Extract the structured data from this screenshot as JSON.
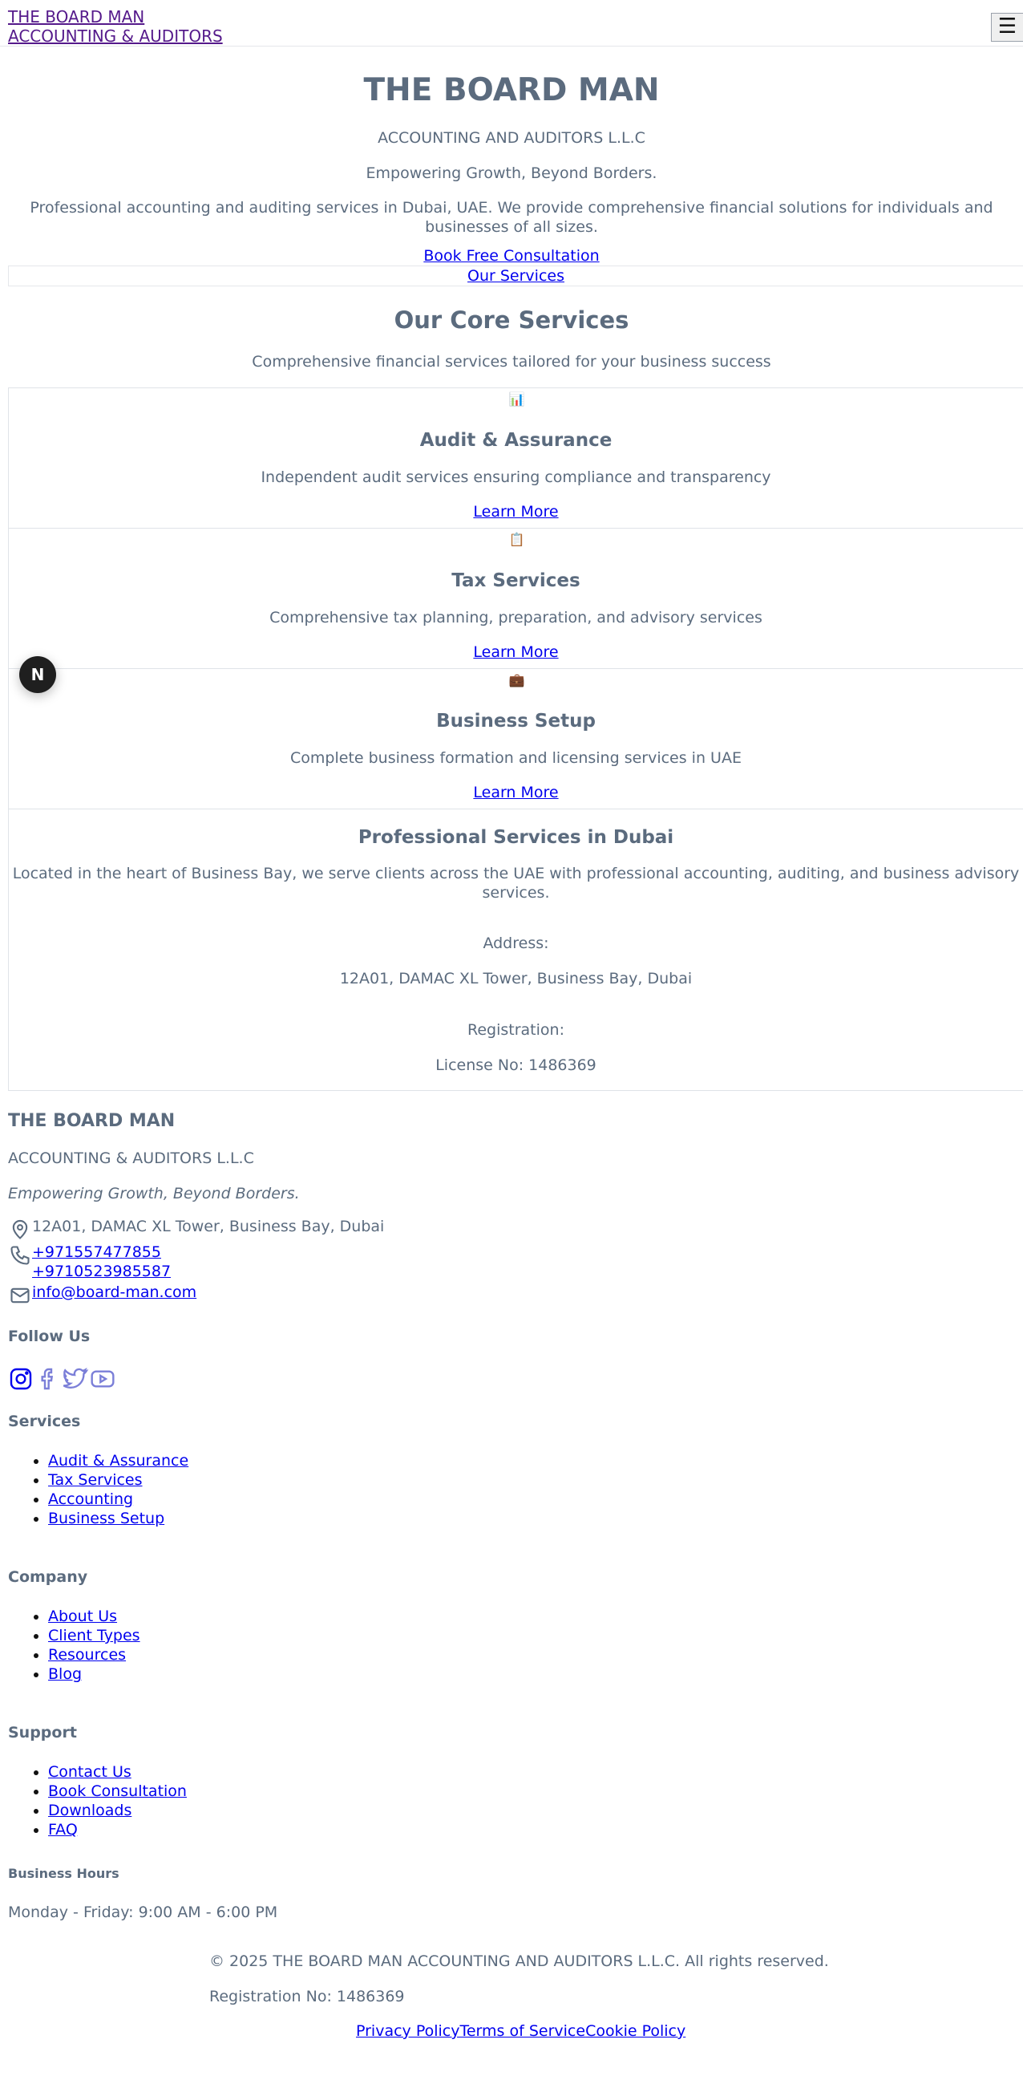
{
  "header": {
    "logo_line1": "THE BOARD MAN",
    "logo_line2": "ACCOUNTING & AUDITORS",
    "menu_icon": "☰"
  },
  "hero": {
    "title": "THE BOARD MAN",
    "subtitle": "ACCOUNTING AND AUDITORS L.L.C",
    "tagline": "Empowering Growth, Beyond Borders.",
    "description": "Professional accounting and auditing services in Dubai, UAE. We provide comprehensive financial solutions for individuals and businesses of all sizes.",
    "cta_primary": "Book Free Consultation",
    "cta_secondary": "Our Services"
  },
  "core": {
    "title": "Our Core Services",
    "subtitle": "Comprehensive financial services tailored for your business success",
    "services": [
      {
        "icon": "bar-chart-icon",
        "glyph": "📊",
        "title": "Audit & Assurance",
        "desc": "Independent audit services ensuring compliance and transparency",
        "link": "Learn More"
      },
      {
        "icon": "clipboard-icon",
        "glyph": "📋",
        "title": "Tax Services",
        "desc": "Comprehensive tax planning, preparation, and advisory services",
        "link": "Learn More"
      },
      {
        "icon": "briefcase-icon",
        "glyph": "💼",
        "title": "Business Setup",
        "desc": "Complete business formation and licensing services in UAE",
        "link": "Learn More"
      }
    ]
  },
  "professional": {
    "title": "Professional Services in Dubai",
    "desc_line1": "Located in the heart of Business Bay, we serve clients across the UAE with professional accounting, auditing, and business advisory",
    "desc_line2": "services.",
    "address_label": "Address:",
    "address_value": "12A01, DAMAC XL Tower, Business Bay, Dubai",
    "registration_label": "Registration:",
    "registration_value": "License No: 1486369"
  },
  "badge": {
    "letter": "N"
  },
  "footer": {
    "brand": "THE BOARD MAN",
    "sub": "ACCOUNTING & AUDITORS L.L.C",
    "tagline": "Empowering Growth, Beyond Borders.",
    "address": "12A01, DAMAC XL Tower, Business Bay, Dubai",
    "phone1": "+971557477855",
    "phone2": "+9710523985587",
    "email": "info@board-man.com",
    "follow_heading": "Follow Us",
    "social": [
      "instagram-icon",
      "facebook-icon",
      "twitter-icon",
      "youtube-icon"
    ],
    "services_heading": "Services",
    "services": [
      "Audit & Assurance",
      "Tax Services",
      "Accounting",
      "Business Setup"
    ],
    "company_heading": "Company",
    "company": [
      "About Us",
      "Client Types",
      "Resources",
      "Blog"
    ],
    "support_heading": "Support",
    "support": [
      "Contact Us",
      "Book Consultation",
      "Downloads",
      "FAQ"
    ],
    "hours_heading": "Business Hours",
    "hours": "Monday - Friday: 9:00 AM - 6:00 PM",
    "copyright": "© 2025 THE BOARD MAN ACCOUNTING AND AUDITORS L.L.C. All rights reserved.",
    "registration": "Registration No: 1486369",
    "privacy": "Privacy Policy",
    "terms": "Terms of Service",
    "cookie": "Cookie Policy"
  },
  "colors": {
    "text": "#5b6b7e",
    "link": "#0000ee",
    "visited": "#551a8b",
    "border": "#dfe3e8",
    "social_icon": "#7b7fd8"
  }
}
